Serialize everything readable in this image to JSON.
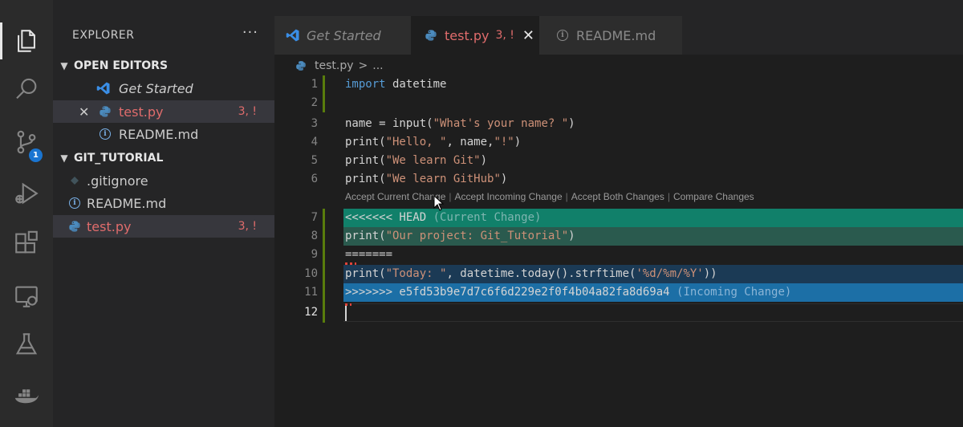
{
  "activity_bar": {
    "items": [
      {
        "icon": "files-icon"
      },
      {
        "icon": "search-icon"
      },
      {
        "icon": "source-control-icon",
        "badge": "1"
      },
      {
        "icon": "run-debug-icon"
      },
      {
        "icon": "extensions-icon"
      },
      {
        "icon": "remote-explorer-icon"
      },
      {
        "icon": "testing-flask-icon"
      },
      {
        "icon": "docker-icon"
      }
    ]
  },
  "sidebar": {
    "title": "EXPLORER",
    "more": "···",
    "open_editors": {
      "label": "OPEN EDITORS",
      "items": [
        {
          "name": "Get Started",
          "status": ""
        },
        {
          "name": "test.py",
          "status": "3, !"
        },
        {
          "name": "README.md",
          "status": ""
        }
      ]
    },
    "folder": {
      "label": "GIT_TUTORIAL",
      "items": [
        {
          "name": ".gitignore",
          "status": ""
        },
        {
          "name": "README.md",
          "status": ""
        },
        {
          "name": "test.py",
          "status": "3, !"
        }
      ]
    }
  },
  "tabs": [
    {
      "label": "Get Started",
      "status": ""
    },
    {
      "label": "test.py",
      "status": "3, !",
      "close": "✕"
    },
    {
      "label": "README.md",
      "status": ""
    }
  ],
  "breadcrumb": {
    "file": "test.py",
    "sep": ">",
    "more": "..."
  },
  "codelens": [
    "Accept Current Change",
    "Accept Incoming Change",
    "Accept Both Changes",
    "Compare Changes"
  ],
  "editor": {
    "line_numbers": [
      "1",
      "2",
      "3",
      "4",
      "5",
      "6",
      "7",
      "8",
      "9",
      "10",
      "11",
      "12"
    ],
    "lines": {
      "l1_kw": "import",
      "l1_rest": " datetime",
      "l3_a": "name = input(",
      "l3_s": "\"What's your name? \"",
      "l3_b": ")",
      "l4_a": "print(",
      "l4_s1": "\"Hello, \"",
      "l4_b": ", name,",
      "l4_s2": "\"!\"",
      "l4_c": ")",
      "l5_a": "print(",
      "l5_s": "\"We learn Git\"",
      "l5_b": ")",
      "l6_a": "print(",
      "l6_s": "\"We learn GitHub\"",
      "l6_b": ")",
      "l7_marker": "<<<<<<< HEAD",
      "l7_hint": "(Current Change)",
      "l8_a": "print(",
      "l8_s": "\"Our project: Git_Tutorial\"",
      "l8_b": ")",
      "l9": "=======",
      "l10_a": "print(",
      "l10_s1": "\"Today: \"",
      "l10_b": ", datetime.today().strftime(",
      "l10_s2": "'%d/%m/%Y'",
      "l10_c": "))",
      "l11_marker": ">>>>>>> e5fd53b9e7d7c6f6d229e2f0f4b04a82fa8d69a4",
      "l11_hint": "(Incoming Change)"
    }
  },
  "colors": {
    "current_change_header": "#11806a",
    "current_change_body": "#2a5a4e",
    "incoming_change_header": "#1c6fa6",
    "incoming_change_body": "#1b3a55",
    "error": "#e06c6c",
    "python_icon": "#4b8bbe"
  }
}
